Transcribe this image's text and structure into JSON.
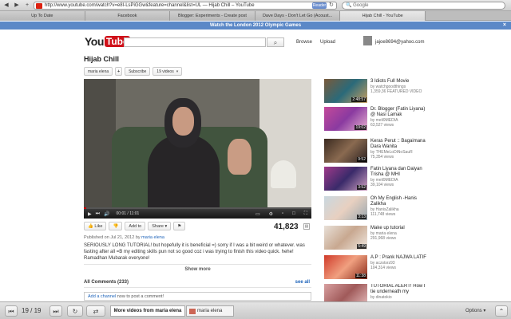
{
  "browser": {
    "back_icon": "back-arrow-icon",
    "forward_icon": "forward-arrow-icon",
    "url": "http://www.youtube.com/watch?v=e8I-LsPiGGw&feature=channel&list=UL — Hijab Chill – YouTube",
    "reader_label": "Reader",
    "search_placeholder": "Google",
    "tabs": [
      {
        "label": "Up To Date"
      },
      {
        "label": "Facebook"
      },
      {
        "label": "Blogger: Experiments - Create post"
      },
      {
        "label": "Dave Days - Don't Let Go (Acoust..."
      },
      {
        "label": "Hijab Chill - YouTube"
      }
    ],
    "banner": "Watch the London 2012 Olympic Games"
  },
  "youtube": {
    "logo_you": "You",
    "logo_tube": "Tube",
    "browse": "Browse",
    "upload": "Upload",
    "user_email": "jajoe8694@yahoo.com",
    "title": "Hijab Chill",
    "channel_name": "maria elena",
    "subscribe": "Subscribe",
    "video_count": "19 videos",
    "player": {
      "time": "00:01 / 11:01",
      "progress": 0.01
    },
    "actions": {
      "like": "Like",
      "add_to": "Add to",
      "share": "Share"
    },
    "views": "41,823",
    "published_prefix": "Published on Jul 21, 2012 by",
    "published_channel": "maria elena",
    "description": "SERIOUSLY LONG TUTORIAL! but hopefully it is beneficial =) sorry if I was a bit weird or whatever. was fasting after all =B my editing skills pun not so good coz i was trying to finish this video quick. hehe! Ramadhan Mubarak everyone!",
    "show_more": "Show more",
    "comments_title": "All Comments (233)",
    "see_all": "see all",
    "comment_link": "Add a channel",
    "comment_prompt": "now to post a comment!"
  },
  "related": [
    {
      "title": "3 Idiots Full Movie",
      "meta1": "by watchgoodthings",
      "meta2": "1,359,36 FEATURED VIDEO",
      "duration": "2:48:57"
    },
    {
      "title": "Dr. Blogger (Fatin Liyana) @ Nasi Lamak",
      "meta1": "by meli9MEDIA",
      "meta2": "63,527 views",
      "duration": "19:02"
    },
    {
      "title": "Keras Perut :: Bagaimana Dara Wanita",
      "meta1": "by THEMeLoDiNoSauR",
      "meta2": "75,354 views",
      "duration": "9:52"
    },
    {
      "title": "Fatin Liyana dan Daiyan Trisha @ MHI",
      "meta1": "by meli9MEDIA",
      "meta2": "39,104 views",
      "duration": "3:52"
    },
    {
      "title": "Oh My English -Hanis Zalikha",
      "meta1": "by HanisZalikha",
      "meta2": "111,748 views",
      "duration": "3:13"
    },
    {
      "title": "Make up tutorial",
      "meta1": "by maria elena",
      "meta2": "291,968 views",
      "duration": "5:49"
    },
    {
      "title": "A.P : Prank NAJWA LATIF",
      "meta1": "by aczstsrz93",
      "meta2": "104,314 views",
      "duration": "11:38"
    },
    {
      "title": "TUTORIAL ALERT! How I tie underneath my",
      "meta1": "by dinatokio",
      "meta2": "",
      "duration": ""
    }
  ],
  "bottom_bar": {
    "page_counter": "19 / 19",
    "more_videos": "More videos from maria elena",
    "channel_chip": "maria elena",
    "options": "Options"
  },
  "colors": {
    "youtube_red": "#d0111a",
    "link_blue": "#1c62b9",
    "banner_blue": "#5b88c7"
  }
}
